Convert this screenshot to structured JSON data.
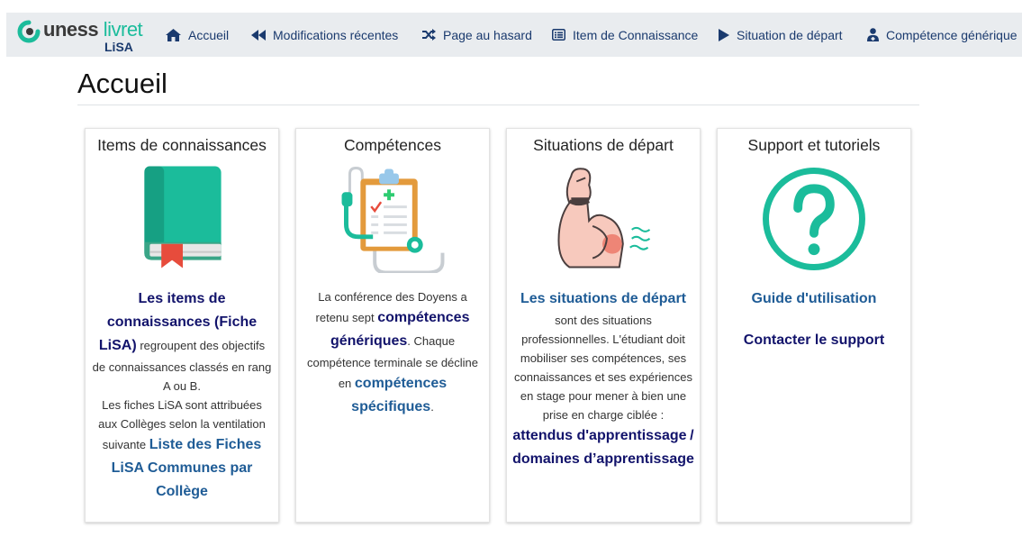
{
  "brand": {
    "word1": "uness",
    "word2": "livret",
    "sub": "LiSA"
  },
  "nav": [
    {
      "label": "Accueil",
      "icon": "home-icon"
    },
    {
      "label": "Modifications récentes",
      "icon": "rewind-icon"
    },
    {
      "label": "Page au hasard",
      "icon": "shuffle-icon"
    },
    {
      "label": "Item de Connaissance",
      "icon": "list-icon"
    },
    {
      "label": "Situation de départ",
      "icon": "play-icon"
    },
    {
      "label": "Compétence générique",
      "icon": "user-doctor-icon"
    }
  ],
  "page_title": "Accueil",
  "cards": [
    {
      "title": "Items de connaissances",
      "illustration": "book-icon",
      "link1": "Les items de connaissances (Fiche LiSA)",
      "text1": "regroupent des objectifs de connaissances classés en rang A ou B.",
      "text2": "Les fiches LiSA sont attribuées aux Collèges selon la ventilation suivante",
      "link2": "Liste des Fiches LiSA Communes par Collège"
    },
    {
      "title": "Compétences",
      "illustration": "clipboard-stethoscope-icon",
      "text1": "La conférence des Doyens a retenu sept",
      "link1": "compétences génériques",
      "text2": ". Chaque compétence terminale se décline en",
      "link2": "compétences spécifiques",
      "text3": "."
    },
    {
      "title": "Situations de départ",
      "illustration": "back-pain-patient-icon",
      "link1": "Les situations de départ",
      "text1": "sont des situations professionnelles. L'étudiant doit mobiliser ses compétences, ses connaissances et ses expériences en stage pour mener à bien une prise en charge ciblée :",
      "link2": "attendus d'apprentissage",
      "sep": "/",
      "link3": "domaines d’apprentissage"
    },
    {
      "title": "Support et tutoriels",
      "illustration": "question-circle-icon",
      "link1": "Guide d'utilisation",
      "link2": "Contacter le support"
    }
  ],
  "colors": {
    "accent": "#1bbc9b",
    "navbar_bg": "#e9ecef",
    "link": "#1f5c96",
    "link_dark": "#12136b"
  }
}
